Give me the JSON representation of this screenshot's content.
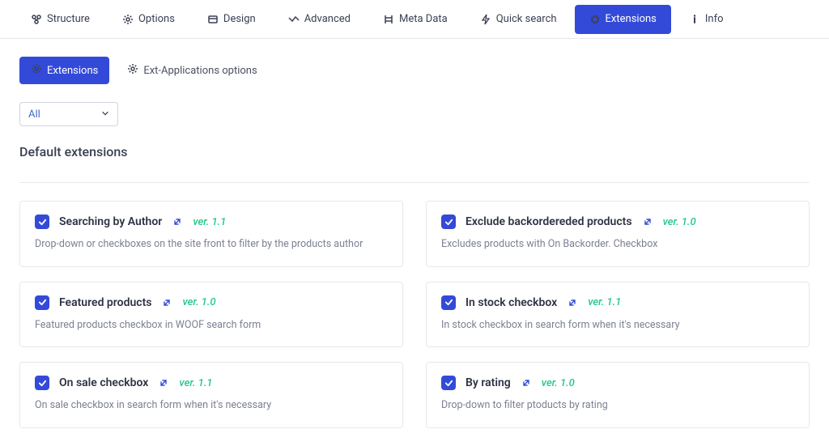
{
  "tabs": {
    "structure": "Structure",
    "options": "Options",
    "design": "Design",
    "advanced": "Advanced",
    "meta": "Meta Data",
    "quick": "Quick search",
    "extensions": "Extensions",
    "info": "Info"
  },
  "subtabs": {
    "extensions": "Extensions",
    "extapps": "Ext-Applications options"
  },
  "filter": {
    "value": "All"
  },
  "section_heading": "Default extensions",
  "cards": [
    {
      "title": "Searching by Author",
      "ver": "ver. 1.1",
      "desc": "Drop-down or checkboxes on the site front to filter by the products author"
    },
    {
      "title": "Exclude backordereded products",
      "ver": "ver. 1.0",
      "desc": "Excludes products with On Backorder. Checkbox"
    },
    {
      "title": "Featured products",
      "ver": "ver. 1.0",
      "desc": "Featured products checkbox in WOOF search form"
    },
    {
      "title": "In stock checkbox",
      "ver": "ver. 1.1",
      "desc": "In stock checkbox in search form when it's necessary"
    },
    {
      "title": "On sale checkbox",
      "ver": "ver. 1.1",
      "desc": "On sale checkbox in search form when it's necessary"
    },
    {
      "title": "By rating",
      "ver": "ver. 1.0",
      "desc": "Drop-down to filter ptoducts by rating"
    }
  ]
}
